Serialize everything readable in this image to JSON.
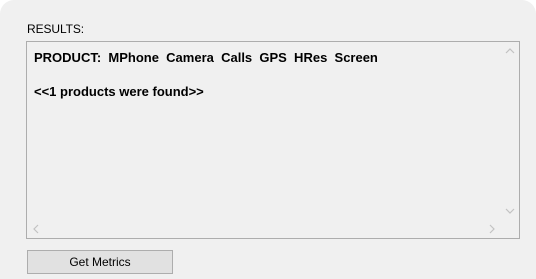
{
  "results": {
    "label": "RESULTS:",
    "lines": [
      "PRODUCT:  MPhone  Camera  Calls  GPS  HRes  Screen",
      "<<1 products were found>>"
    ]
  },
  "scrollbars": {
    "up_icon": "chevron-up-icon",
    "down_icon": "chevron-down-icon",
    "left_icon": "chevron-left-icon",
    "right_icon": "chevron-right-icon"
  },
  "actions": {
    "get_metrics_label": "Get Metrics"
  }
}
